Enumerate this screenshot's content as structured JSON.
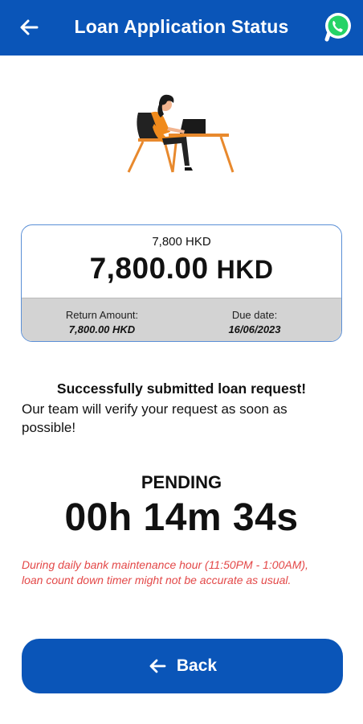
{
  "header": {
    "title": "Loan Application Status",
    "back_icon": "back-arrow-icon",
    "chat_icon": "whatsapp-icon"
  },
  "loan": {
    "amount_small": "7,800 HKD",
    "amount_value": "7,800.00",
    "amount_currency": "HKD",
    "return_label": "Return Amount:",
    "return_value": "7,800.00 HKD",
    "due_label": "Due date:",
    "due_value": "16/06/2023"
  },
  "message": {
    "title": "Successfully submitted loan request!",
    "body": "Our team will verify your request as soon as possible!"
  },
  "status": {
    "label": "PENDING",
    "timer": "00h 14m 34s"
  },
  "note": "During daily bank maintenance hour (11:50PM - 1:00AM), loan count down timer might not be accurate as usual.",
  "footer": {
    "back_label": "Back"
  },
  "colors": {
    "primary": "#0a55b8",
    "warning": "#e34848",
    "whatsapp": "#25d366"
  }
}
